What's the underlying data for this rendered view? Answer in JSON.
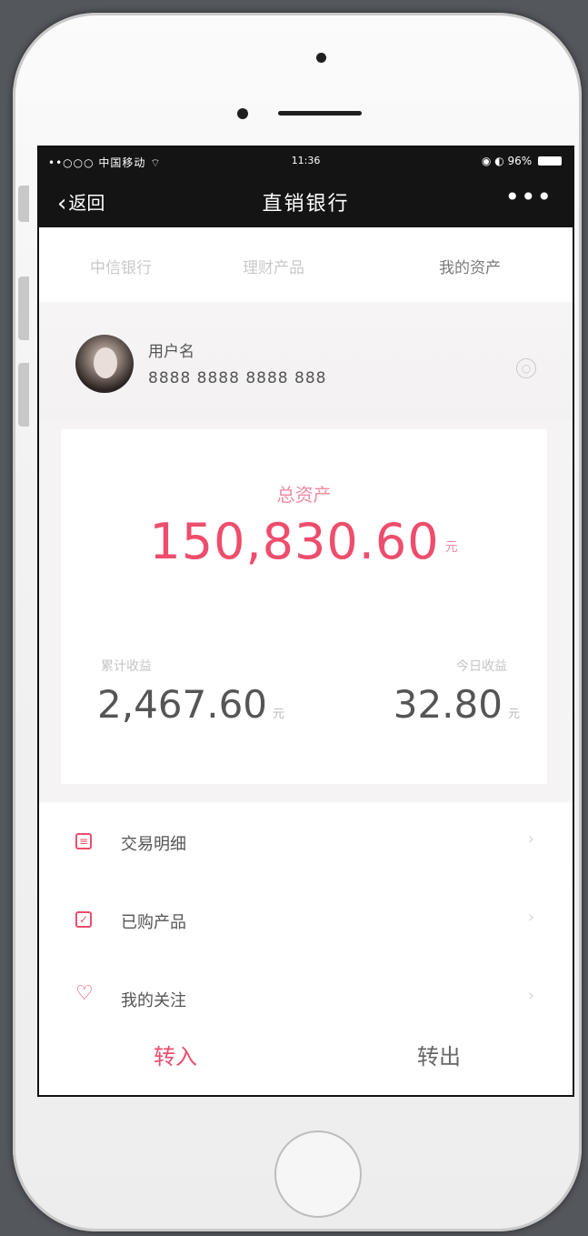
{
  "status_bar": {
    "carrier": "••○○○ 中国移动 ",
    "time": "11:36",
    "battery": "96%"
  },
  "nav": {
    "back_label": "返回",
    "title": "直销银行",
    "more_label": "•••"
  },
  "tabs": [
    {
      "label": "中信银行",
      "active": false
    },
    {
      "label": "理财产品",
      "active": false
    },
    {
      "label": "我的资产",
      "active": true
    }
  ],
  "user": {
    "name": "用户名",
    "card_number": "8888 8888 8888 888"
  },
  "assets": {
    "total_label": "总资产",
    "total_amount": "150,830.60",
    "total_unit": "元",
    "left_label": "累计收益",
    "left_value": "2,467.60",
    "left_unit": "元",
    "right_label": "今日收益",
    "right_value": "32.80",
    "right_unit": "元"
  },
  "menu": [
    {
      "label": "交易明细"
    },
    {
      "label": "已购产品"
    },
    {
      "label": "我的关注"
    }
  ],
  "bottom": {
    "transfer_in": "转入",
    "transfer_out": "转出"
  },
  "colors": {
    "accent": "#ee4d6c",
    "nav_bg": "#141414"
  }
}
